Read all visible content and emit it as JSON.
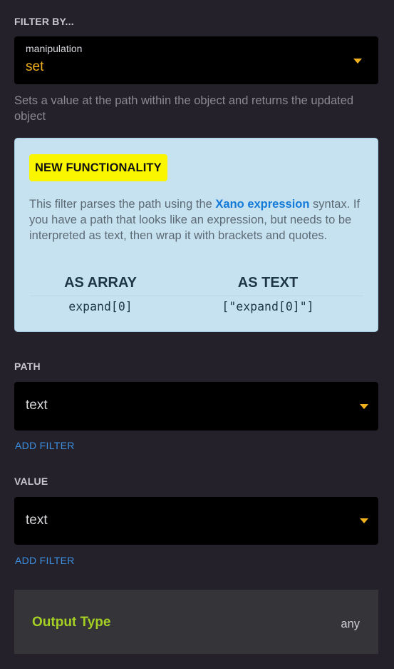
{
  "filter_section": {
    "heading": "FILTER BY...",
    "select_label": "manipulation",
    "selected_value": "set",
    "description": "Sets a value at the path within the object and returns the updated object"
  },
  "info_box": {
    "badge": "NEW FUNCTIONALITY",
    "text_before_link": "This filter parses the path using the ",
    "link_text": "Xano expression",
    "text_after_link": " syntax. If you have a path that looks like an expression, but needs to be interpreted as text, then wrap it with brackets and quotes.",
    "col1_heading": "AS ARRAY",
    "col1_code": "expand[0]",
    "col2_heading": "AS TEXT",
    "col2_code": "[\"expand[0]\"]"
  },
  "path_section": {
    "heading": "PATH",
    "value": "text",
    "add_filter": "ADD FILTER"
  },
  "value_section": {
    "heading": "VALUE",
    "value": "text",
    "add_filter": "ADD FILTER"
  },
  "output": {
    "label": "Output Type",
    "value": "any"
  },
  "colors": {
    "background": "#25212a",
    "accent_gold": "#f2b21e",
    "link_blue": "#137ad8",
    "output_green": "#a4cf23",
    "badge_yellow": "#faf600",
    "info_bg": "#c6e2f1"
  }
}
